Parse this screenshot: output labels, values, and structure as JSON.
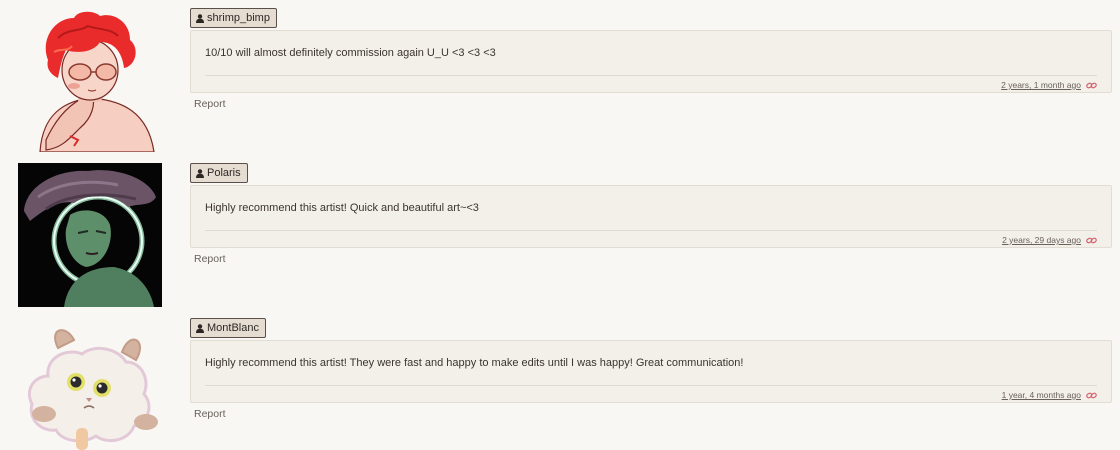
{
  "comments": [
    {
      "username": "shrimp_bimp",
      "text": "10/10 will almost definitely commission again U_U <3 <3 <3",
      "timestamp": "2 years, 1 month ago",
      "report_label": "Report",
      "avatar_icon": "user-icon"
    },
    {
      "username": "Polaris",
      "text": "Highly recommend this artist! Quick and beautiful art~<3",
      "timestamp": "2 years, 29 days ago",
      "report_label": "Report",
      "avatar_icon": "user-icon"
    },
    {
      "username": "MontBlanc",
      "text": "Highly recommend this artist! They were fast and happy to make edits until I was happy! Great communication!",
      "timestamp": "1 year, 4 months ago",
      "report_label": "Report",
      "avatar_icon": "user-icon"
    }
  ],
  "colors": {
    "background": "#f9f7f3",
    "bubble": "#f3efe9",
    "tag": "#e5dcd2",
    "link_icon": "#d4616e"
  }
}
